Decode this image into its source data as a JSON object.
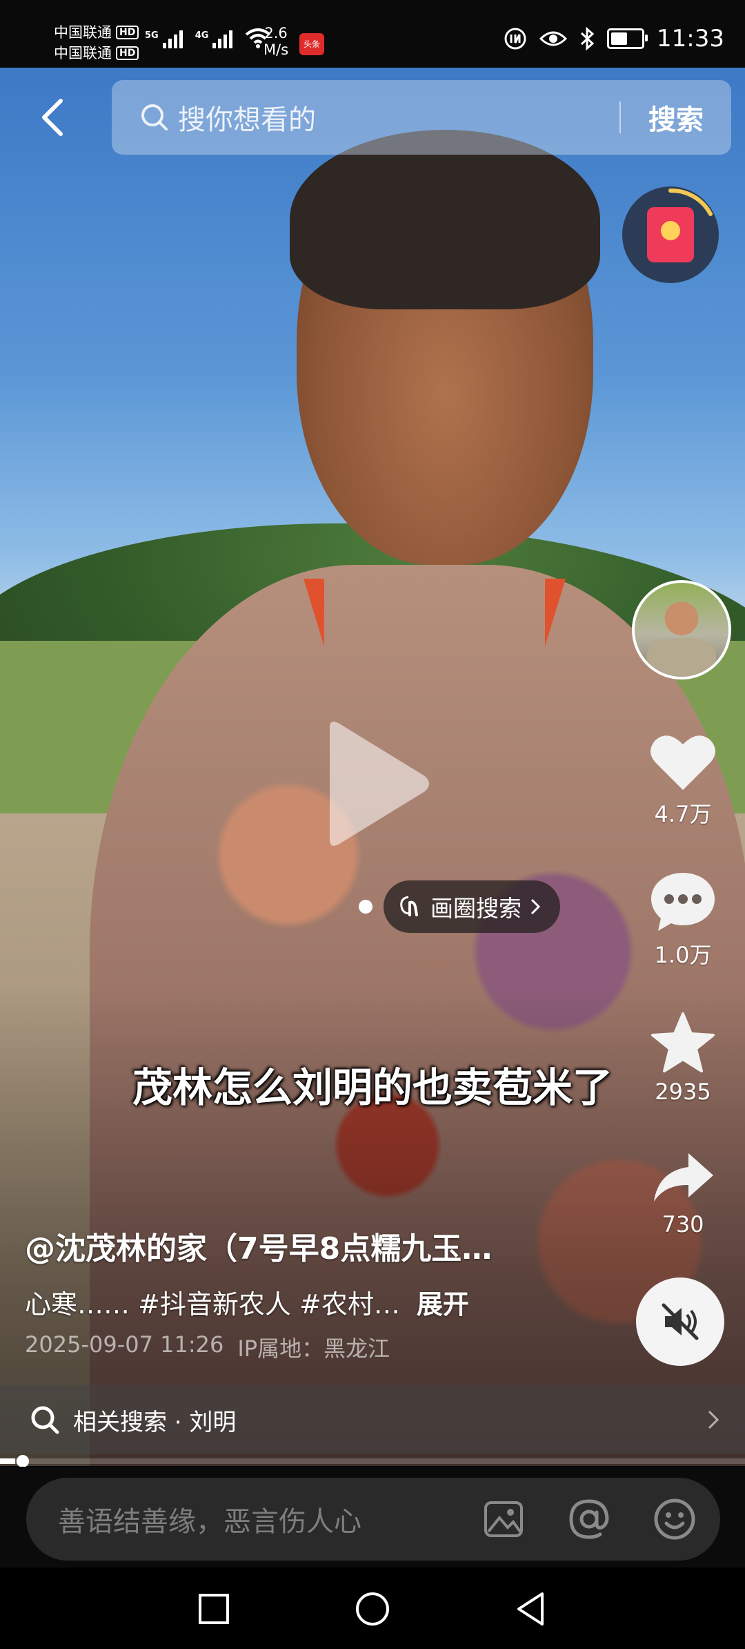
{
  "status_bar": {
    "carrier_1": "中国联通",
    "carrier_2": "中国联通",
    "hd": "HD",
    "net_1": "5G",
    "net_2": "4G",
    "speed_value": "2.6",
    "speed_unit": "M/s",
    "app_badge": "头条",
    "time": "11:33",
    "battery_level": 0.6
  },
  "top": {
    "search_placeholder": "搜你想看的",
    "search_button": "搜索"
  },
  "subtitle": "茂林怎么刘明的也卖苞米了",
  "circle_search": {
    "label": "画圈搜索"
  },
  "rail": {
    "likes": "4.7万",
    "comments": "1.0万",
    "favorites": "2935",
    "shares": "730"
  },
  "video_info": {
    "author": "@沈茂林的家（7号早8点糯九玉…",
    "description": "心寒…… #抖音新农人 #农村…",
    "expand": "展开",
    "date": "2025-09-07 11:26",
    "ip_location": "IP属地：黑龙江"
  },
  "related_search": {
    "label": "相关搜索 · 刘明"
  },
  "progress": 0.02,
  "comment_bar": {
    "placeholder": "善语结善缘，恶言伤人心"
  },
  "colors": {
    "accent_red": "#f03a5a",
    "collar_orange": "#e0522e",
    "comment_bar_bg": "#2a2a2a"
  },
  "icons": [
    "back-icon",
    "search-icon",
    "red-envelope-icon",
    "heart-icon",
    "comment-icon",
    "star-icon",
    "share-icon",
    "mute-icon",
    "play-icon",
    "circle-search-icon",
    "image-icon",
    "at-icon",
    "emoji-icon",
    "recent-apps-icon",
    "home-icon",
    "back-nav-icon"
  ]
}
